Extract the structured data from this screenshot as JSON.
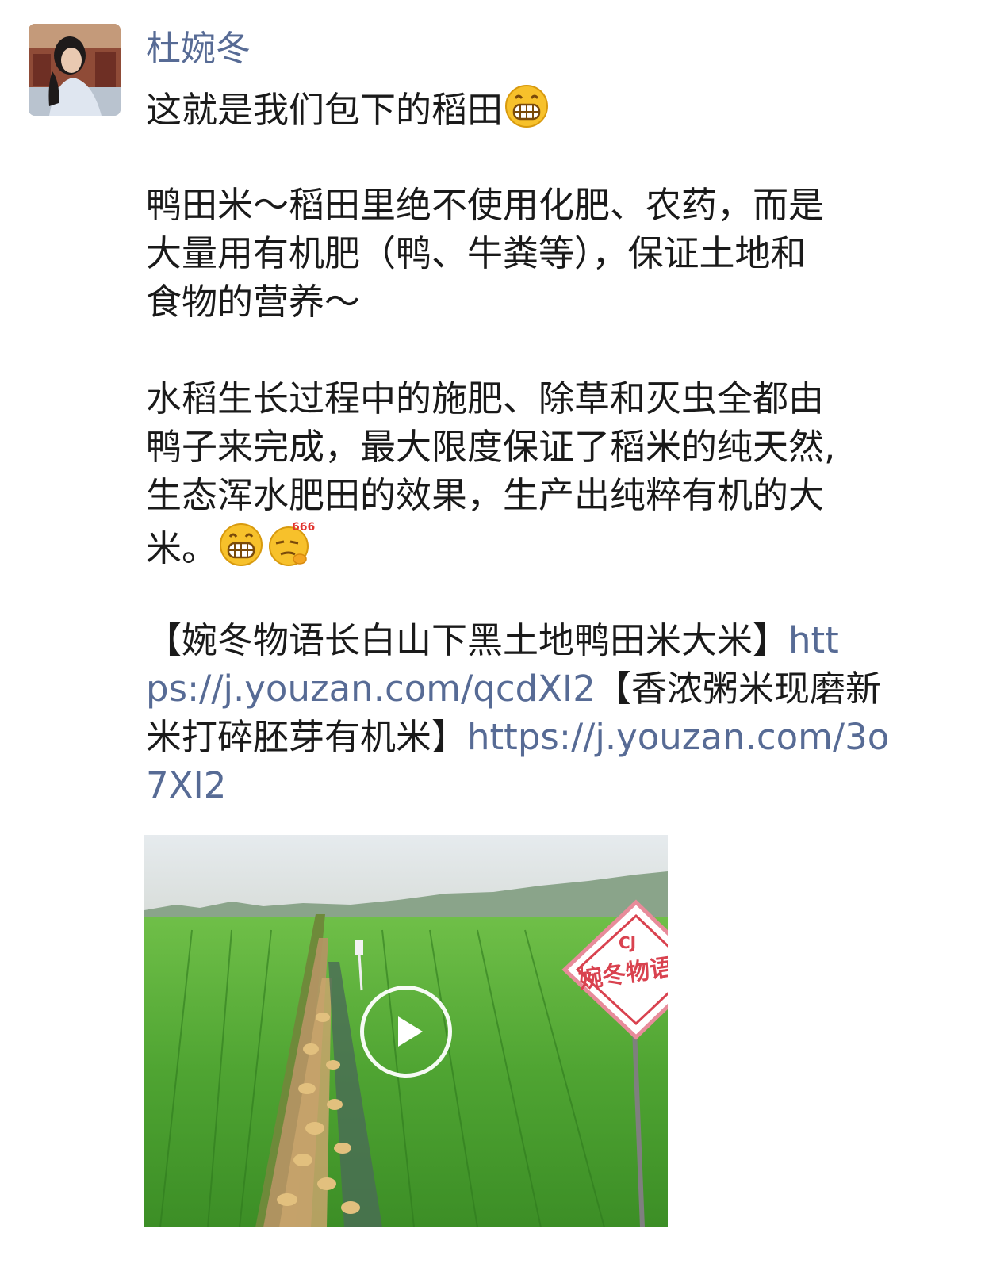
{
  "post": {
    "author": "杜婉冬",
    "lines": [
      "这就是我们包下的稻田",
      "",
      "鸭田米～稻田里绝不使用化肥、农药，而是",
      "大量用有机肥（鸭、牛粪等），保证土地和",
      "食物的营养～",
      "",
      "水稻生长过程中的施肥、除草和灭虫全都由",
      "鸭子来完成，最大限度保证了稻米的纯天然,",
      "生态浑水肥田的效果，生产出纯粹有机的大",
      "米。"
    ],
    "link_block": {
      "l1_text": "【婉冬物语长白山下黑土地鸭田米大米】",
      "l1_link": "htt",
      "l2_link": "ps://j.youzan.com/qcdXI2",
      "l2_text": "【香浓粥米现磨新",
      "l3_text": "米打碎胚芽有机米】",
      "l3_link": "https://j.youzan.com/3o",
      "l4_link": "7XI2"
    },
    "emoji": {
      "grin": "grin-emoji",
      "smirk_666": "666-emoji",
      "smirk_label": "666"
    },
    "video": {
      "sign_text": "婉冬物语",
      "sign_logo": "CJ",
      "play_icon": "play-icon"
    }
  }
}
